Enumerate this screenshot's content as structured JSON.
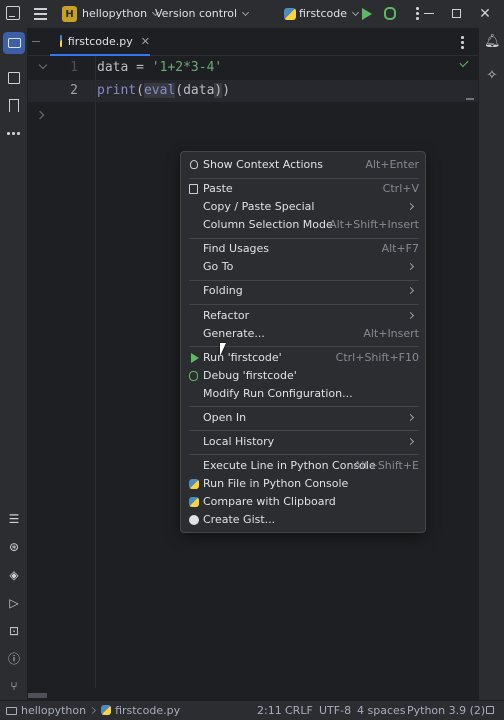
{
  "titlebar": {
    "project_badge": "H",
    "project_name": "hellopython",
    "vcs": "Version control",
    "run_config": "firstcode"
  },
  "tabs": [
    {
      "label": "firstcode.py",
      "active": true
    }
  ],
  "editor": {
    "lines": [
      {
        "number": "1",
        "tokens": [
          "data = ",
          "'1+2*3-4'"
        ]
      },
      {
        "number": "2",
        "tokens": [
          "print",
          "(",
          "eval",
          "(data",
          ")",
          ")"
        ]
      }
    ],
    "colors": {
      "string": "#6aab73",
      "builtin": "#8888c6",
      "text": "#bcbec4"
    }
  },
  "context_menu": {
    "items": [
      {
        "label": "Show Context Actions",
        "shortcut": "Alt+Enter",
        "icon": "lightbulb-icon"
      },
      {
        "label": "Paste",
        "shortcut": "Ctrl+V",
        "icon": "clipboard-paste-icon"
      },
      {
        "label": "Copy / Paste Special",
        "submenu": true
      },
      {
        "label": "Column Selection Mode",
        "shortcut": "Alt+Shift+Insert"
      },
      {
        "label": "Find Usages",
        "shortcut": "Alt+F7"
      },
      {
        "label": "Go To",
        "submenu": true
      },
      {
        "label": "Folding",
        "submenu": true
      },
      {
        "label": "Refactor",
        "submenu": true
      },
      {
        "label": "Generate...",
        "shortcut": "Alt+Insert"
      },
      {
        "label": "Run 'firstcode'",
        "shortcut": "Ctrl+Shift+F10",
        "icon": "run-icon"
      },
      {
        "label": "Debug 'firstcode'",
        "icon": "debug-icon"
      },
      {
        "label": "Modify Run Configuration..."
      },
      {
        "label": "Open In",
        "submenu": true
      },
      {
        "label": "Local History",
        "submenu": true
      },
      {
        "label": "Execute Line in Python Console",
        "shortcut": "Alt+Shift+E"
      },
      {
        "label": "Run File in Python Console",
        "icon": "python-icon"
      },
      {
        "label": "Compare with Clipboard",
        "icon": "compare-icon"
      },
      {
        "label": "Create Gist...",
        "icon": "github-icon"
      }
    ]
  },
  "statusbar": {
    "crumb_project": "hellopython",
    "crumb_file": "firstcode.py",
    "position": "2:11",
    "line_separator": "CRLF",
    "encoding": "UTF-8",
    "indent": "4 spaces",
    "interpreter": "Python 3.9 (2)"
  },
  "accent": "#3574f0"
}
